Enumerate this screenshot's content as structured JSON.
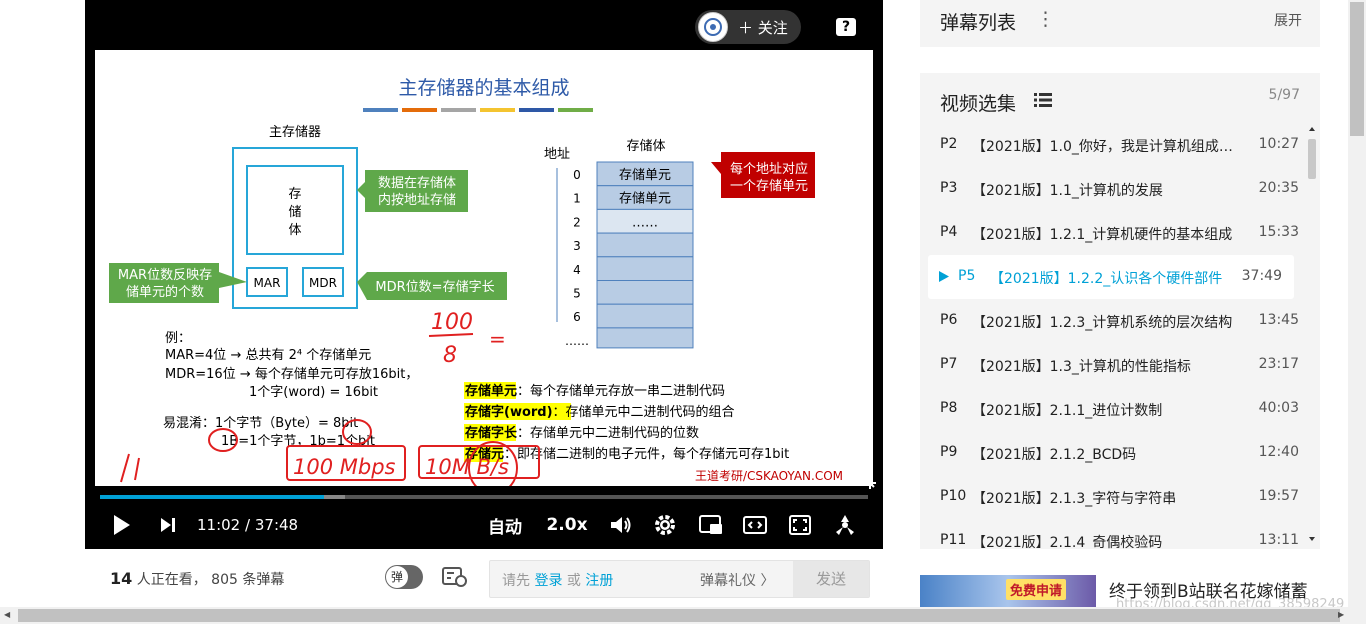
{
  "player": {
    "follow_label": "＋ 关注",
    "help_glyph": "?",
    "time_current": "11:02",
    "time_separator": "/",
    "time_total": "37:48",
    "progress_fraction": 0.292,
    "buffer_fraction": 0.319,
    "quality_label": "自动",
    "speed_label": "2.0x"
  },
  "slide": {
    "title": "主存储器的基本组成",
    "main_memory_label": "主存储器",
    "storage_body_label": "存储体",
    "storage_body_vertical": [
      "存",
      "储",
      "体"
    ],
    "mar": "MAR",
    "mdr": "MDR",
    "callout_data": [
      "数据在存储体",
      "内按地址存储"
    ],
    "callout_mar": [
      "MAR位数反映存",
      "储单元的个数"
    ],
    "callout_mdr": "MDR位数=存储字长",
    "address_label": "地址",
    "addresses": [
      "0",
      "1",
      "2",
      "3",
      "4",
      "5",
      "6",
      "……"
    ],
    "cells": [
      "存储单元",
      "存储单元",
      "……",
      "",
      "",
      "",
      "",
      ""
    ],
    "callout_address": [
      "每个地址对应",
      "一个存储单元"
    ],
    "example_heading": "例：",
    "example_line1": "MAR=4位 → 总共有 2⁴ 个存储单元",
    "example_line2": "MDR=16位 → 每个存储单元可存放16bit，",
    "example_line3": "1个字(word) = 16bit",
    "confuse_line1": "易混淆：1个字节（Byte）= 8bit",
    "confuse_line2": "1B=1个字节，1b=1个bit",
    "definitions": [
      {
        "term": "存储单元",
        "text": "：每个存储单元存放一串二进制代码"
      },
      {
        "term": "存储字(word)",
        "text": "：存储单元中二进制代码的组合"
      },
      {
        "term": "存储字长",
        "text": "：存储单元中二进制代码的位数"
      },
      {
        "term": "存储元",
        "text": "：即存储二进制的电子元件，每个存储元可存1bit"
      }
    ],
    "handwritten_fraction_top": "100",
    "handwritten_fraction_bottom": "8",
    "handwritten_equals": "=",
    "handwritten_mbps": "100 Mbps",
    "handwritten_mbs": "10M B/s",
    "brand": "王道考研/CSKAOYAN.COM",
    "color_bar": [
      "#4f81bd",
      "#e46c0a",
      "#a5a5a5",
      "#f4c430",
      "#2e58a6",
      "#70ad47"
    ]
  },
  "below": {
    "viewers_count": "14",
    "viewers_suffix": " 人正在看，",
    "danmu_count": "805",
    "danmu_suffix": " 条弹幕",
    "toggle_label": "弹",
    "prompt_prefix": "请先 ",
    "login": "登录",
    "or": " 或 ",
    "register": "注册",
    "etiquette": "弹幕礼仪 〉",
    "send": "发送"
  },
  "danmu_list": {
    "title": "弹幕列表",
    "more": "⋮",
    "expand": "展开"
  },
  "episodes": {
    "title": "视频选集",
    "count": "5/97",
    "items": [
      {
        "p": "P2",
        "name": "【2021版】1.0_你好，我是计算机组成…",
        "dur": "10:27"
      },
      {
        "p": "P3",
        "name": "【2021版】1.1_计算机的发展",
        "dur": "20:35"
      },
      {
        "p": "P4",
        "name": "【2021版】1.2.1_计算机硬件的基本组成",
        "dur": "15:33"
      },
      {
        "p": "P5",
        "name": "【2021版】1.2.2_认识各个硬件部件",
        "dur": "37:49"
      },
      {
        "p": "P6",
        "name": "【2021版】1.2.3_计算机系统的层次结构",
        "dur": "13:45"
      },
      {
        "p": "P7",
        "name": "【2021版】1.3_计算机的性能指标",
        "dur": "23:17"
      },
      {
        "p": "P8",
        "name": "【2021版】2.1.1_进位计数制",
        "dur": "40:03"
      },
      {
        "p": "P9",
        "name": "【2021版】2.1.2_BCD码",
        "dur": "12:40"
      },
      {
        "p": "P10",
        "name": "【2021版】2.1.3_字符与字符串",
        "dur": "19:57"
      },
      {
        "p": "P11",
        "name": "【2021版】2.1.4_奇偶校验码",
        "dur": "13:11"
      }
    ]
  },
  "promo": {
    "thumb_label": "免费申请",
    "title": "终于领到B站联名花嫁储蓄"
  },
  "watermark": "https://blog.csdn.net/qq_38598249",
  "colors": {
    "accent": "#00a1d6",
    "panel": "#f4f4f4",
    "callout_green": "#5fa84a",
    "callout_red": "#c00000",
    "cell_blue": "#b8cce4"
  }
}
